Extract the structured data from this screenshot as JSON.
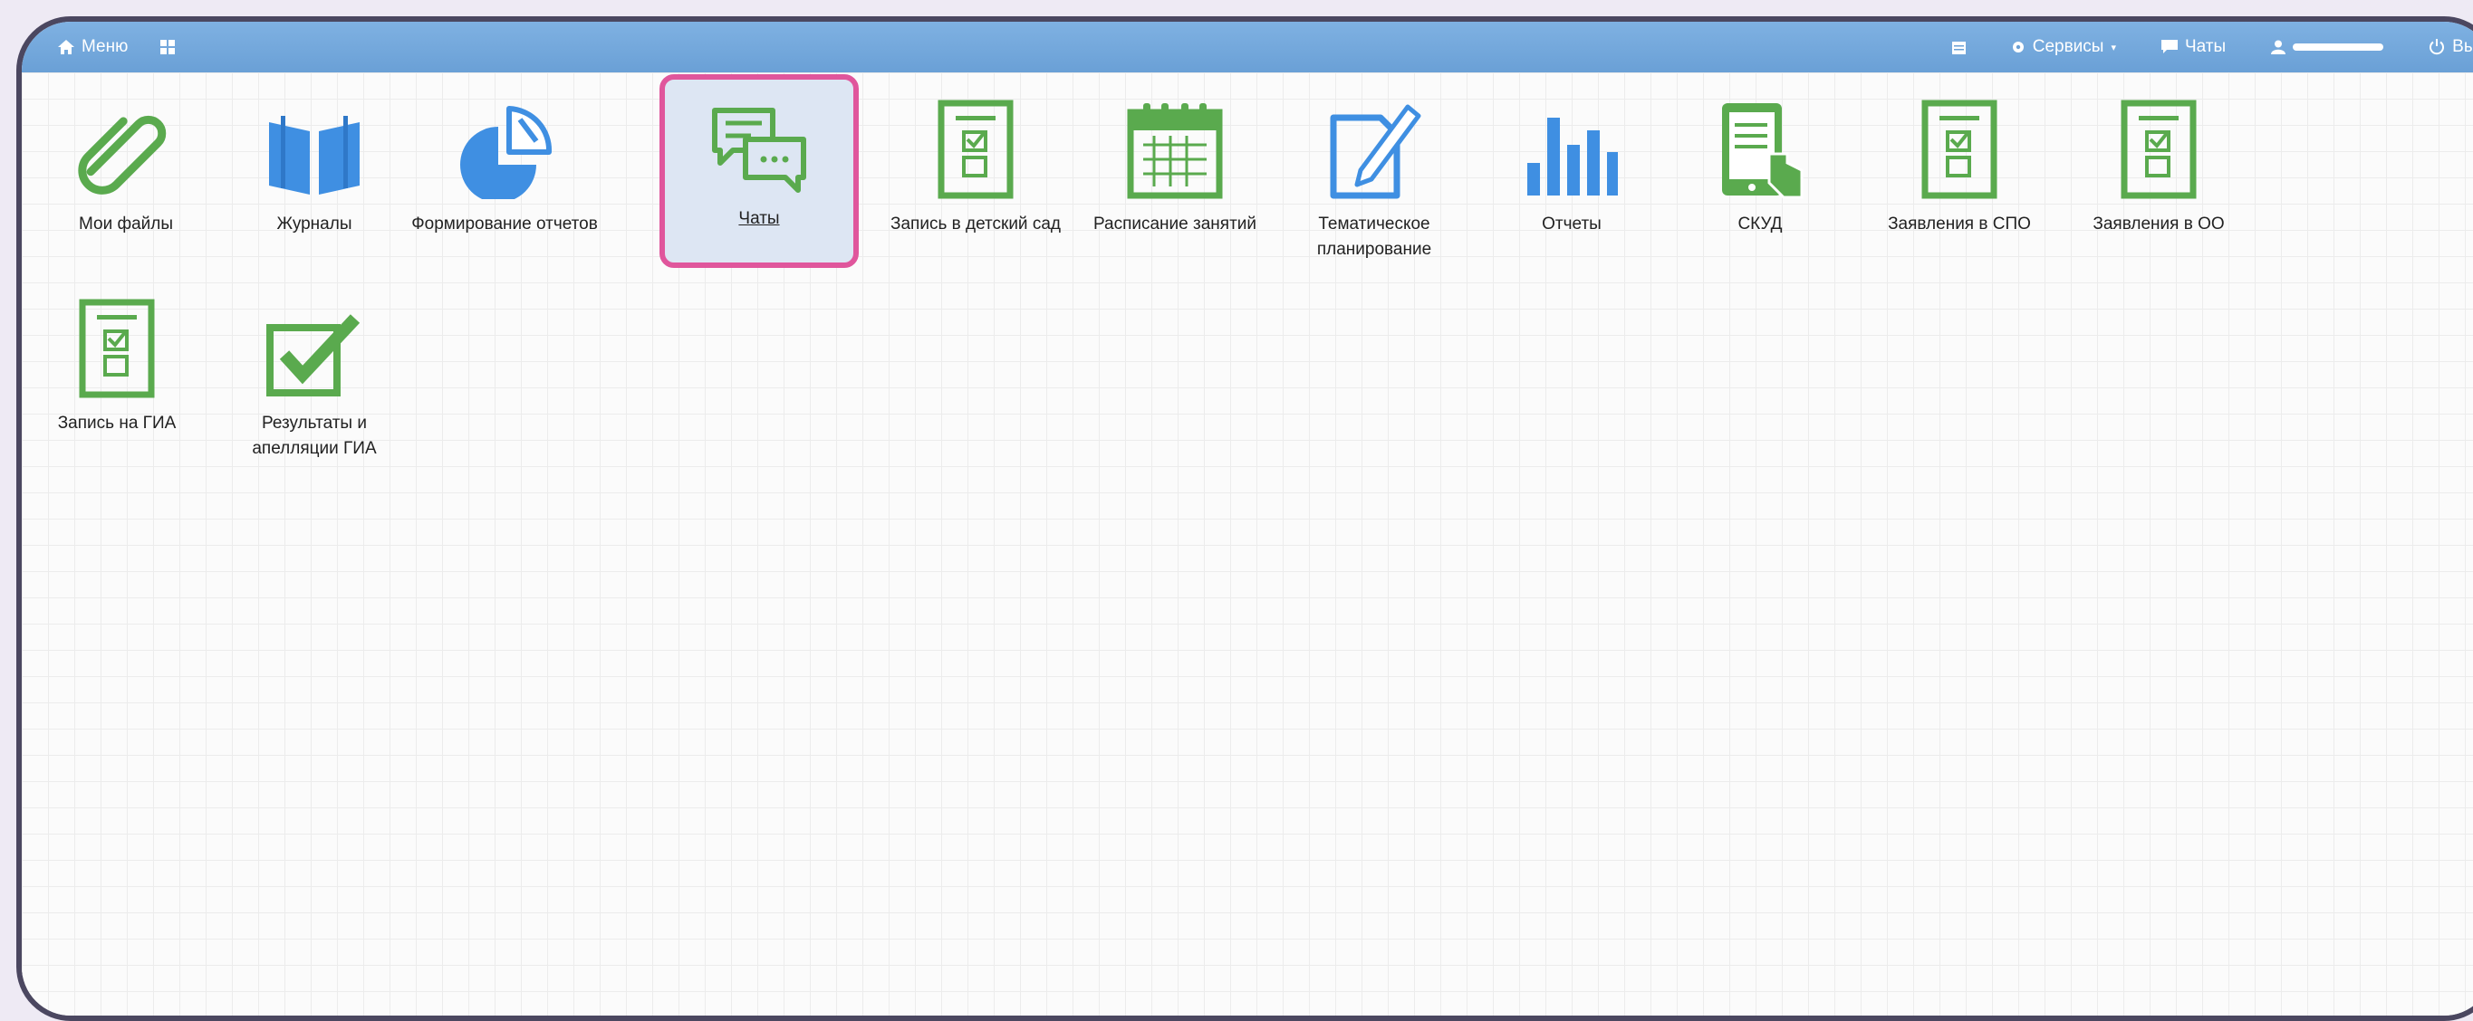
{
  "topbar": {
    "menu_label": "Меню",
    "services_label": "Сервисы",
    "chats_label": "Чаты",
    "exit_label": "Выход"
  },
  "tiles": [
    {
      "label": "Мои файлы",
      "icon": "paperclip-icon"
    },
    {
      "label": "Журналы",
      "icon": "open-book-icon"
    },
    {
      "label": "Формирование отчетов",
      "icon": "pie-chart-icon"
    },
    {
      "label": "Чаты",
      "icon": "chat-bubbles-icon",
      "active": true
    },
    {
      "label": "Запись в детский сад",
      "icon": "form-checklist-icon"
    },
    {
      "label": "Расписание занятий",
      "icon": "calendar-icon"
    },
    {
      "label": "Тематическое планирование",
      "icon": "document-pencil-icon"
    },
    {
      "label": "Отчеты",
      "icon": "bar-chart-icon"
    },
    {
      "label": "СКУД",
      "icon": "tablet-hand-icon"
    },
    {
      "label": "Заявления в СПО",
      "icon": "form-checklist-icon"
    },
    {
      "label": "Заявления в ОО",
      "icon": "form-checklist-icon"
    },
    {
      "label": "Запись на ГИА",
      "icon": "form-checklist-icon"
    },
    {
      "label": "Результаты и апелляции ГИА",
      "icon": "checkbox-check-icon"
    }
  ],
  "colors": {
    "topbar": "#6aa0d6",
    "green": "#5aaa4e",
    "blue": "#3f8fe2",
    "highlight_border": "#e0569c"
  }
}
